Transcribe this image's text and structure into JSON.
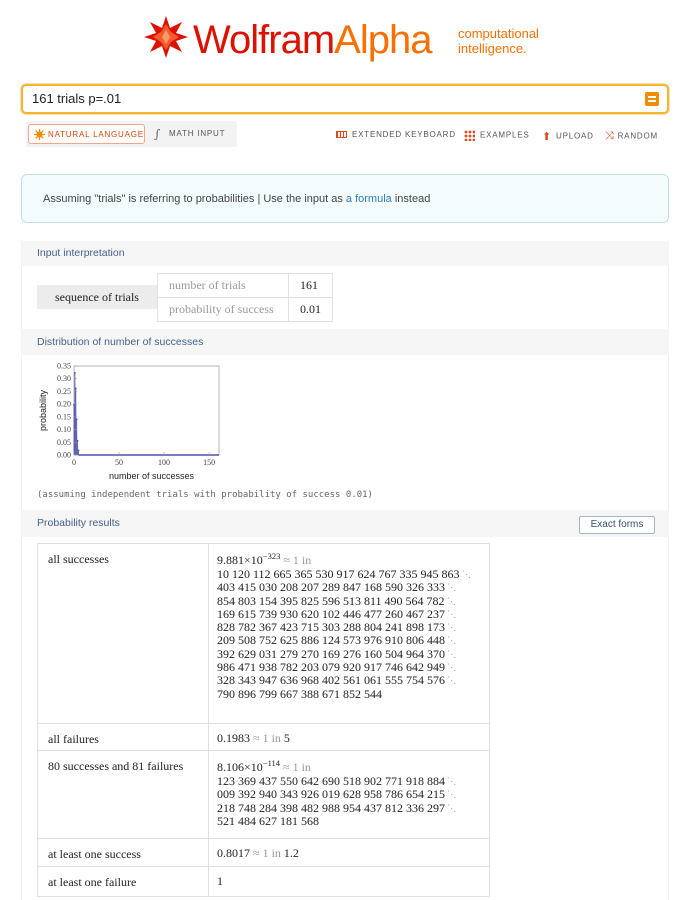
{
  "logo": {
    "wolfram": "Wolfram",
    "alpha": "Alpha",
    "tagline_line1": "computational",
    "tagline_line2": "intelligence."
  },
  "search": {
    "value": "161 trials p=.01"
  },
  "modes": {
    "natural_language": "NATURAL LANGUAGE",
    "math_input": "MATH INPUT"
  },
  "tools": {
    "extended_keyboard": "EXTENDED KEYBOARD",
    "examples": "EXAMPLES",
    "upload": "UPLOAD",
    "random": "RANDOM"
  },
  "assumption": {
    "prefix": "Assuming \"trials\" is referring to probabilities | Use the input as ",
    "link": "a formula",
    "suffix": " instead"
  },
  "pods": {
    "input_title": "Input interpretation",
    "distribution_title": "Distribution of number of successes",
    "results_title": "Probability results",
    "exact_forms": "Exact forms"
  },
  "interpretation": {
    "label": "sequence of trials",
    "rows": [
      {
        "key": "number of trials",
        "value": "161"
      },
      {
        "key": "probability of success",
        "value": "0.01"
      }
    ]
  },
  "plot": {
    "footnote": "(assuming independent trials with probability of success 0.01)",
    "xlabel": "number of successes",
    "ylabel": "probability",
    "chart_data": {
      "type": "bar",
      "x": [
        0,
        1,
        2,
        3,
        4,
        5
      ],
      "values": [
        0.198,
        0.323,
        0.262,
        0.14,
        0.056,
        0.018
      ],
      "xticks": [
        "0",
        "50",
        "100",
        "150"
      ],
      "yticks": [
        "0.00",
        "0.05",
        "0.10",
        "0.15",
        "0.20",
        "0.25",
        "0.30",
        "0.35"
      ],
      "xlim": [
        0,
        161
      ],
      "ylim": [
        0,
        0.35
      ],
      "xlabel": "number of successes",
      "ylabel": "probability"
    }
  },
  "results": [
    {
      "label": "all successes",
      "mantissa": "9.881",
      "times": "×",
      "base": "10",
      "exp": "−323",
      "approx": "≈ 1 in",
      "digits": [
        "10 120 112 665 365 530 917 624 767 335 945 863",
        "403 415 030 208 207 289 847 168 590 326 333",
        "854 803 154 395 825 596 513 811 490 564 782",
        "169 615 739 930 620 102 446 477 260 467 237",
        "828 782 367 423 715 303 288 804 241 898 173",
        "209 508 752 625 886 124 573 976 910 806 448",
        "392 629 031 279 270 169 276 160 504 964 370",
        "986 471 938 782 203 079 920 917 746 642 949",
        "328 343 947 636 968 402 561 061 555 754 576",
        "790 896 799 667 388 671 852 544"
      ]
    },
    {
      "label": "all failures",
      "value": "0.1983",
      "approx": "≈ 1 in",
      "in": "5"
    },
    {
      "label": "80 successes and 81 failures",
      "mantissa": "8.106",
      "times": "×",
      "base": "10",
      "exp": "−114",
      "approx": "≈ 1 in",
      "digits": [
        "123 369 437 550 642 690 518 902 771 918 884",
        "009 392 940 343 926 019 628 958 786 654 215",
        "218 748 284 398 482 988 954 437 812 336 297",
        "521 484 627 181 568"
      ]
    },
    {
      "label": "at least one success",
      "value": "0.8017",
      "approx": "≈ 1 in",
      "in": "1.2"
    },
    {
      "label": "at least one failure",
      "value": "1"
    }
  ],
  "colors": {
    "brand_red": "#dd1100",
    "brand_orange": "#f96f00",
    "search_border": "#f4b42e",
    "link": "#2f7fb5",
    "plot_series": "#5050a8"
  },
  "icons": {
    "logo": "spiky-star-icon",
    "go": "equals-icon",
    "nl": "sun-icon",
    "math": "integral-icon"
  }
}
